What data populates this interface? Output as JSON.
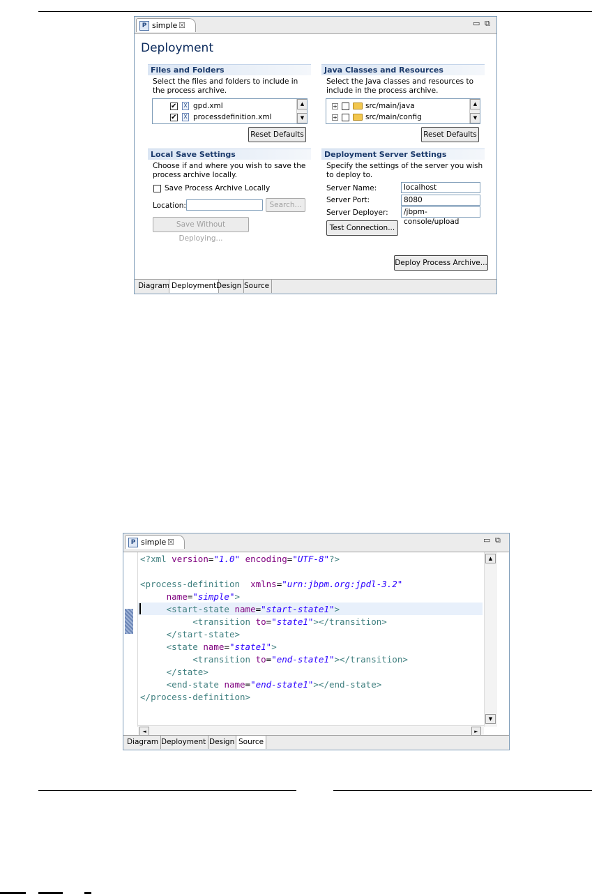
{
  "top_window": {
    "tab_title": "simple",
    "form_title": "Deployment",
    "files_section": {
      "title": "Files and Folders",
      "description": "Select the files and folders to include in the process archive.",
      "items": [
        {
          "label": "gpd.xml",
          "checked": true
        },
        {
          "label": "processdefinition.xml",
          "checked": true
        }
      ],
      "reset_label": "Reset Defaults"
    },
    "java_section": {
      "title": "Java Classes and Resources",
      "description": "Select the Java classes and resources to include in the process archive.",
      "items": [
        {
          "label": "src/main/java",
          "checked": false
        },
        {
          "label": "src/main/config",
          "checked": false
        }
      ],
      "reset_label": "Reset Defaults"
    },
    "local_section": {
      "title": "Local Save Settings",
      "description": "Choose if and where you wish to save the process archive locally.",
      "save_checkbox_label": "Save Process Archive Locally",
      "location_label": "Location:",
      "location_value": "",
      "search_label": "Search...",
      "save_without_deploy_label": "Save Without Deploying..."
    },
    "server_section": {
      "title": "Deployment Server Settings",
      "description": "Specify the settings of the server you wish to deploy to.",
      "server_name_label": "Server Name:",
      "server_name_value": "localhost",
      "server_port_label": "Server Port:",
      "server_port_value": "8080",
      "server_deployer_label": "Server Deployer:",
      "server_deployer_value": "/jbpm-console/upload",
      "test_connection_label": "Test Connection..."
    },
    "deploy_label": "Deploy Process Archive...",
    "bottom_tabs": [
      "Diagram",
      "Deployment",
      "Design",
      "Source"
    ],
    "selected_tab": "Deployment"
  },
  "bottom_window": {
    "tab_title": "simple",
    "code_lines": [
      "<?xml version=\"1.0\" encoding=\"UTF-8\"?>",
      "",
      "<process-definition  xmlns=\"urn:jbpm.org:jpdl-3.2\"",
      "     name=\"simple\">",
      "     <start-state name=\"start-state1\">",
      "          <transition to=\"state1\"></transition>",
      "     </start-state>",
      "     <state name=\"state1\">",
      "          <transition to=\"end-state1\"></transition>",
      "     </state>",
      "     <end-state name=\"end-state1\"></end-state>",
      "</process-definition>"
    ],
    "bottom_tabs": [
      "Diagram",
      "Deployment",
      "Design",
      "Source"
    ],
    "selected_tab": "Source"
  },
  "icons": {
    "editor_icon": "P",
    "close_glyph": "☒",
    "minimize_glyph": "▭",
    "maximize_glyph": "⧉",
    "xml_file_glyph": "X",
    "scroll_up": "▲",
    "scroll_down": "▼",
    "scroll_left": "◄",
    "scroll_right": "►",
    "tree_expand": "+"
  }
}
